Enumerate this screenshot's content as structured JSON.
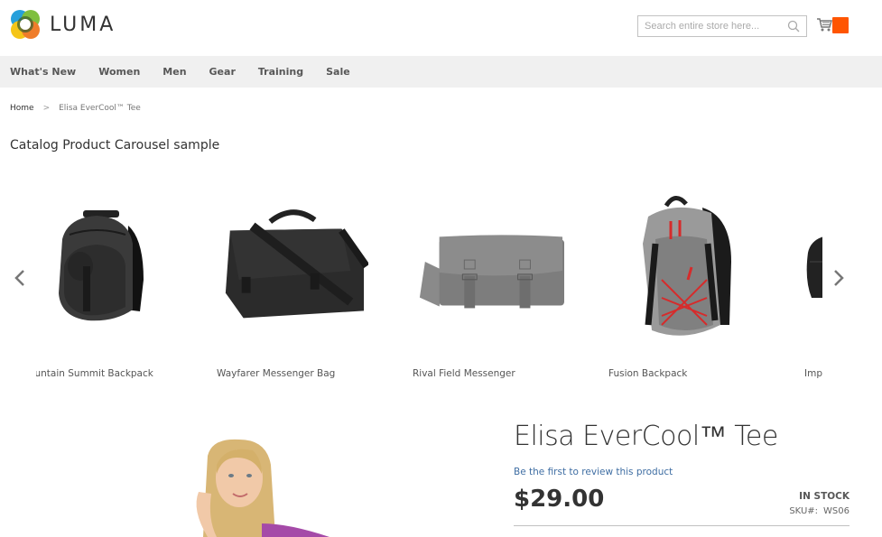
{
  "header": {
    "logo_text": "LUMA",
    "search": {
      "placeholder": "Search entire store here...",
      "value": ""
    },
    "cart_badge_color": "#ff5501"
  },
  "nav": {
    "items": [
      {
        "label": "What's New"
      },
      {
        "label": "Women"
      },
      {
        "label": "Men"
      },
      {
        "label": "Gear"
      },
      {
        "label": "Training"
      },
      {
        "label": "Sale"
      }
    ]
  },
  "breadcrumb": {
    "home": "Home",
    "separator": ">",
    "current": "Elisa EverCool™ Tee"
  },
  "carousel": {
    "title": "Catalog Product Carousel sample",
    "prev_icon": "chevron-left-icon",
    "next_icon": "chevron-right-icon",
    "items": [
      {
        "name": "Mountain Summit Backpack",
        "image": "black-backpack"
      },
      {
        "name": "Wayfarer Messenger Bag",
        "image": "black-messenger-bag"
      },
      {
        "name": "Rival Field Messenger",
        "image": "gray-messenger-bag"
      },
      {
        "name": "Fusion Backpack",
        "image": "gray-red-backpack"
      },
      {
        "name": "Impulse Duffle",
        "image": "black-duffle"
      }
    ]
  },
  "product": {
    "title": "Elisa EverCool™ Tee",
    "review_link": "Be the first to review this product",
    "price": "$29.00",
    "stock": "IN STOCK",
    "sku_label": "SKU#:",
    "sku_value": "WS06"
  }
}
